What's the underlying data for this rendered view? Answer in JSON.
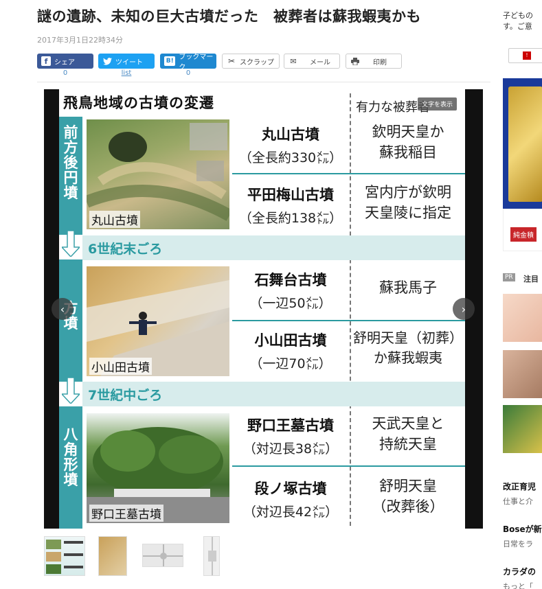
{
  "article": {
    "title": "謎の遺跡、未知の巨大古墳だった　被葬者は蘇我蝦夷かも",
    "date": "2017年3月1日22時34分"
  },
  "share": {
    "facebook": {
      "label": "シェア",
      "count": "0"
    },
    "twitter": {
      "label": "ツイート",
      "count": "list"
    },
    "hatena": {
      "label": "ブックマーク",
      "count": "0"
    },
    "scrap": {
      "label": "スクラップ"
    },
    "mail": {
      "label": "メール"
    },
    "print": {
      "label": "印刷"
    }
  },
  "graphic": {
    "title": "飛鳥地域の古墳の変遷",
    "col_header": "有力な被葬者",
    "show_text_button": "文字を表示",
    "eras": [
      {
        "shape": "前方後円墳"
      },
      {
        "shape": "方墳"
      },
      {
        "shape": "八角形墳"
      }
    ],
    "separators": [
      "6世紀末ごろ",
      "7世紀中ごろ"
    ],
    "photos": [
      "丸山古墳",
      "小山田古墳",
      "野口王墓古墳"
    ],
    "tombs": [
      {
        "name": "丸山古墳",
        "size": "（全長約330㍍）",
        "person": "欽明天皇か\n蘇我稲目"
      },
      {
        "name": "平田梅山古墳",
        "size": "（全長約138㍍）",
        "person": "宮内庁が欽明\n天皇陵に指定"
      },
      {
        "name": "石舞台古墳",
        "size": "（一辺50㍍）",
        "person": "蘇我馬子"
      },
      {
        "name": "小山田古墳",
        "size": "（一辺70㍍）",
        "person": "舒明天皇（初葬）\nか蘇我蝦夷"
      },
      {
        "name": "野口王墓古墳",
        "size": "（対辺長38㍍）",
        "person": "天武天皇と\n持統天皇"
      },
      {
        "name": "段ノ塚古墳",
        "size": "（対辺長42㍍）",
        "person": "舒明天皇\n（改葬後）"
      }
    ]
  },
  "sidebar": {
    "lines": [
      "子どもの",
      "す。ご意"
    ],
    "ad_text": "純金積",
    "pr_label": "PR",
    "pr_heading": "注目",
    "links": [
      {
        "title": "改正育児",
        "sub": "仕事と介"
      },
      {
        "title": "Boseが新",
        "sub": "日常をラ"
      },
      {
        "title": "カラダの",
        "sub": "もっと「"
      }
    ]
  },
  "colors": {
    "teal": "#3aa0a8",
    "facebook": "#3b5998",
    "twitter": "#1da1f2",
    "hatena": "#1e88d0"
  }
}
